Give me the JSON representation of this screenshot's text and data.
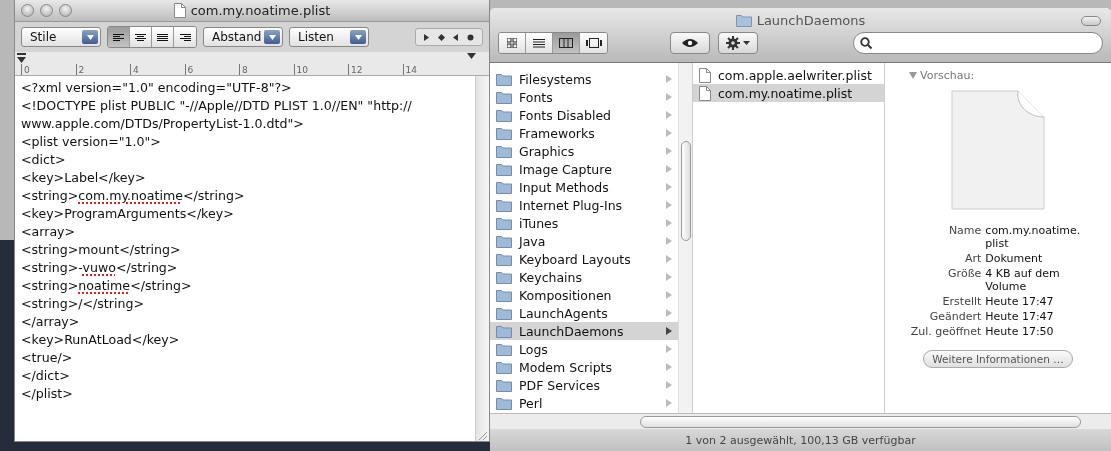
{
  "textedit": {
    "title": "com.my.noatime.plist",
    "toolbar": {
      "style_menu": "Stile",
      "alignment": [
        {
          "kind": "left",
          "selected": true
        },
        {
          "kind": "center",
          "selected": false
        },
        {
          "kind": "justify",
          "selected": false
        },
        {
          "kind": "right",
          "selected": false
        }
      ],
      "spacing_menu": "Abstand",
      "lists_menu": "Listen"
    },
    "ruler": [
      "0",
      "2",
      "4",
      "6",
      "8",
      "10",
      "12",
      "14"
    ],
    "lines": [
      [
        {
          "text": "<?xml version=\"1.0\" encoding=\"UTF-8\"?>",
          "misspelled": false
        }
      ],
      [
        {
          "text": "<!DOCTYPE plist PUBLIC \"-//Apple//DTD PLIST 1.0//EN\" \"http://",
          "misspelled": false
        }
      ],
      [
        {
          "text": "www.apple.com/DTDs/PropertyList-1.0.dtd\">",
          "misspelled": false
        }
      ],
      [
        {
          "text": "<plist version=\"1.0\">",
          "misspelled": false
        }
      ],
      [
        {
          "text": "<dict>",
          "misspelled": false
        }
      ],
      [
        {
          "text": "<key>Label</key>",
          "misspelled": false
        }
      ],
      [
        {
          "text": "<string>",
          "misspelled": false
        },
        {
          "text": "com.my.noatime",
          "misspelled": true
        },
        {
          "text": "</string>",
          "misspelled": false
        }
      ],
      [
        {
          "text": "<key>ProgramArguments</key>",
          "misspelled": false
        }
      ],
      [
        {
          "text": "<array>",
          "misspelled": false
        }
      ],
      [
        {
          "text": "<string>mount</string>",
          "misspelled": false
        }
      ],
      [
        {
          "text": "<string>-",
          "misspelled": false
        },
        {
          "text": "vuwo",
          "misspelled": true
        },
        {
          "text": "</string>",
          "misspelled": false
        }
      ],
      [
        {
          "text": "<string>",
          "misspelled": false
        },
        {
          "text": "noatime",
          "misspelled": true
        },
        {
          "text": "</string>",
          "misspelled": false
        }
      ],
      [
        {
          "text": "<string>/</string>",
          "misspelled": false
        }
      ],
      [
        {
          "text": "</array>",
          "misspelled": false
        }
      ],
      [
        {
          "text": "<key>RunAtLoad</key>",
          "misspelled": false
        }
      ],
      [
        {
          "text": "<true/>",
          "misspelled": false
        }
      ],
      [
        {
          "text": "</dict>",
          "misspelled": false
        }
      ],
      [
        {
          "text": "</plist>",
          "misspelled": false
        }
      ]
    ]
  },
  "finder": {
    "title": "LaunchDaemons",
    "view_modes": [
      {
        "kind": "icons",
        "selected": false
      },
      {
        "kind": "list",
        "selected": false
      },
      {
        "kind": "columns",
        "selected": true
      },
      {
        "kind": "coverflow",
        "selected": false
      }
    ],
    "folders": [
      {
        "name": "Filesystems",
        "selected": false
      },
      {
        "name": "Fonts",
        "selected": false
      },
      {
        "name": "Fonts Disabled",
        "selected": false
      },
      {
        "name": "Frameworks",
        "selected": false
      },
      {
        "name": "Graphics",
        "selected": false
      },
      {
        "name": "Image Capture",
        "selected": false
      },
      {
        "name": "Input Methods",
        "selected": false
      },
      {
        "name": "Internet Plug-Ins",
        "selected": false
      },
      {
        "name": "iTunes",
        "selected": false
      },
      {
        "name": "Java",
        "selected": false
      },
      {
        "name": "Keyboard Layouts",
        "selected": false
      },
      {
        "name": "Keychains",
        "selected": false
      },
      {
        "name": "Kompositionen",
        "selected": false
      },
      {
        "name": "LaunchAgents",
        "selected": false
      },
      {
        "name": "LaunchDaemons",
        "selected": true
      },
      {
        "name": "Logs",
        "selected": false
      },
      {
        "name": "Modem Scripts",
        "selected": false
      },
      {
        "name": "PDF Services",
        "selected": false
      },
      {
        "name": "Perl",
        "selected": false
      }
    ],
    "files": [
      {
        "name": "com.apple.aelwriter.plist",
        "selected": false
      },
      {
        "name": "com.my.noatime.plist",
        "selected": true
      }
    ],
    "preview": {
      "heading": "Vorschau:",
      "info": [
        {
          "label": "Name",
          "value": "com.my.noatime.plist"
        },
        {
          "label": "Art",
          "value": "Dokument"
        },
        {
          "label": "Größe",
          "value": "4 KB auf dem Volume"
        },
        {
          "label": "Erstellt",
          "value": "Heute 17:47"
        },
        {
          "label": "Geändert",
          "value": "Heute 17:47"
        },
        {
          "label": "Zul. geöffnet",
          "value": "Heute 17:50"
        }
      ],
      "button": "Weitere Informationen …"
    },
    "status_bar": "1 von 2 ausgewählt, 100,13 GB verfügbar"
  }
}
